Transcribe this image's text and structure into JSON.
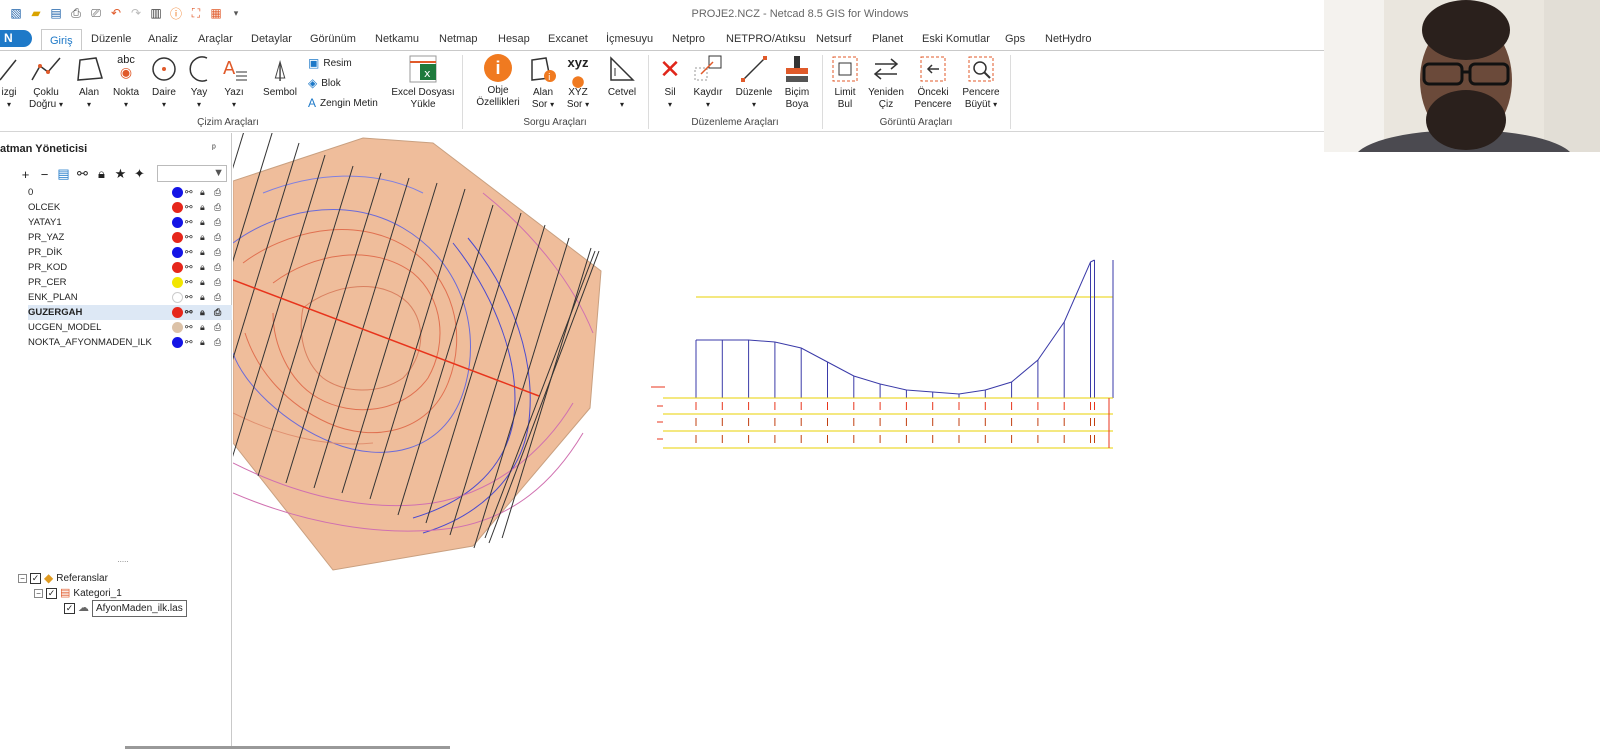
{
  "window": {
    "title": "PROJE2.NCZ - Netcad 8.5 GIS for Windows",
    "minimize_label": "–",
    "restore_label": "❐"
  },
  "app_logo_text": "N",
  "tabs": [
    {
      "label": "Giriş",
      "active": true
    },
    {
      "label": "Düzenle"
    },
    {
      "label": "Analiz"
    },
    {
      "label": "Araçlar"
    },
    {
      "label": "Detaylar"
    },
    {
      "label": "Görünüm"
    },
    {
      "label": "Netkamu"
    },
    {
      "label": "Netmap"
    },
    {
      "label": "Hesap"
    },
    {
      "label": "Excanet"
    },
    {
      "label": "İçmesuyu"
    },
    {
      "label": "Netpro"
    },
    {
      "label": "NETPRO/Atıksu"
    },
    {
      "label": "Netsurf"
    },
    {
      "label": "Planet"
    },
    {
      "label": "Eski Komutlar"
    },
    {
      "label": "Gps"
    },
    {
      "label": "NetHydro"
    }
  ],
  "ribbon": {
    "cizim": {
      "group_label": "Çizim Araçları",
      "cizgi": "izgi",
      "coklu_1": "Çoklu",
      "coklu_2": "Doğru",
      "alan": "Alan",
      "nokta": "Nokta",
      "nokta_glyph": "abc",
      "daire": "Daire",
      "yay": "Yay",
      "yazi": "Yazı",
      "sembol": "Sembol",
      "resim": "Resim",
      "blok": "Blok",
      "zengin_metin": "Zengin Metin",
      "excel_1": "Excel Dosyası",
      "excel_2": "Yükle"
    },
    "sorgu": {
      "group_label": "Sorgu Araçları",
      "obje_1": "Obje",
      "obje_2": "Özellikleri",
      "alan_1": "Alan",
      "alan_2": "Sor",
      "xyz_1": "XYZ",
      "xyz_2": "Sor",
      "xyz_glyph": "xyz",
      "cetvel": "Cetvel"
    },
    "duzenleme": {
      "group_label": "Düzenleme Araçları",
      "sil": "Sil",
      "kaydir": "Kaydır",
      "duzenle": "Düzenle",
      "bicim_1": "Biçim",
      "bicim_2": "Boya"
    },
    "goruntu": {
      "group_label": "Görüntü Araçları",
      "limit_1": "Limit",
      "limit_2": "Bul",
      "yeniden_1": "Yeniden",
      "yeniden_2": "Çiz",
      "onceki_1": "Önceki",
      "onceki_2": "Pencere",
      "pencere_1": "Pencere",
      "pencere_2": "Büyüt"
    }
  },
  "layer_manager": {
    "title": "atman Yöneticisi",
    "pin": "ᵖ",
    "layers": [
      {
        "name": "0",
        "color": "#1414e6"
      },
      {
        "name": "OLCEK",
        "color": "#e6261a"
      },
      {
        "name": "YATAY1",
        "color": "#1414e6"
      },
      {
        "name": "PR_YAZ",
        "color": "#e6261a"
      },
      {
        "name": "PR_DİK",
        "color": "#1414e6"
      },
      {
        "name": "PR_KOD",
        "color": "#e6261a"
      },
      {
        "name": "PR_CER",
        "color": "#f2e600"
      },
      {
        "name": "ENK_PLAN",
        "color": "#ffffff"
      },
      {
        "name": "GUZERGAH",
        "color": "#e6261a",
        "selected": true
      },
      {
        "name": "UCGEN_MODEL",
        "color": "#dcc2a8"
      },
      {
        "name": "NOKTA_AFYONMADEN_ILK",
        "color": "#1414e6"
      }
    ]
  },
  "references": {
    "root": "Referanslar",
    "category": "Kategori_1",
    "file": "AfyonMaden_ilk.las",
    "splitter": "....."
  },
  "map": {
    "route_color": "#e8341c",
    "surface_color": "#efbd9b",
    "profile_color": "#3a3aa8",
    "guide_color": "#e8d000",
    "profile_heights": [
      0.27,
      0.27,
      0.27,
      0.26,
      0.23,
      0.16,
      0.09,
      0.05,
      0.02,
      0.01,
      0.0,
      0.02,
      0.06,
      0.17,
      0.36,
      0.66,
      0.67
    ]
  }
}
